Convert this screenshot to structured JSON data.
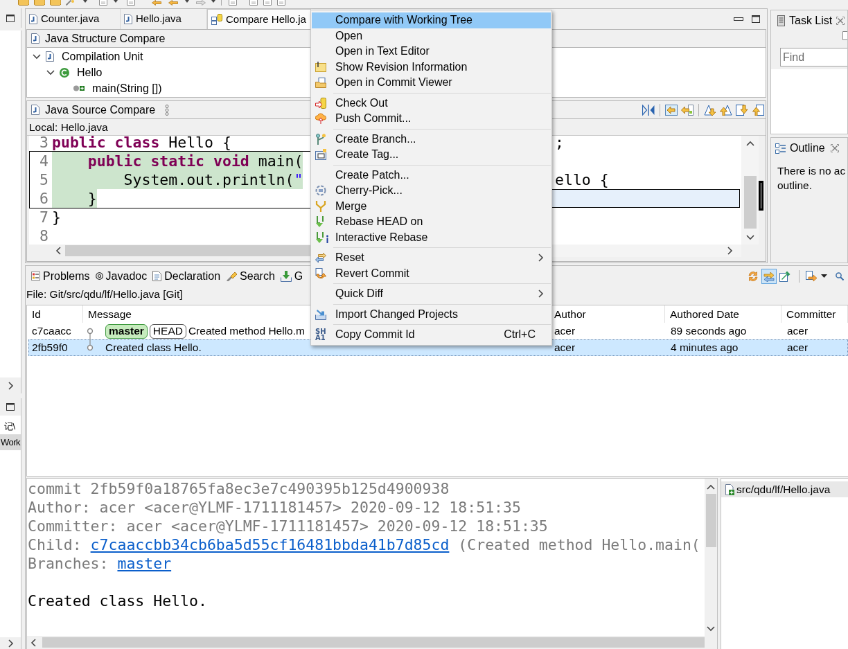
{
  "left_strip": {
    "items": [
      {
        "label": "记\\",
        "selected": false
      },
      {
        "label": "Work",
        "selected": true
      }
    ]
  },
  "editor": {
    "tabs": [
      {
        "label": "Counter.java",
        "kind": "java",
        "selected": false
      },
      {
        "label": "Hello.java",
        "kind": "java",
        "selected": false
      },
      {
        "label": "Compare Hello.ja",
        "kind": "compare",
        "selected": true
      }
    ],
    "structure_compare": {
      "title": "Java Structure Compare",
      "tree": [
        {
          "label": "Compilation Unit",
          "kind": "compilation_unit",
          "expanded": true,
          "children": [
            {
              "label": "Hello",
              "kind": "class",
              "expanded": true,
              "children": [
                {
                  "label": "main(String [])",
                  "kind": "method"
                }
              ]
            }
          ]
        }
      ]
    },
    "source_compare": {
      "title": "Java Source Compare",
      "left_label": "Local: Hello.java",
      "left_lines": [
        {
          "number": "3",
          "changed": false,
          "tokens": [
            {
              "kind": "keyword",
              "text": "public class"
            },
            {
              "kind": "plain",
              "text": " Hello {"
            }
          ]
        },
        {
          "number": "4",
          "changed": true,
          "tokens": [
            {
              "kind": "keyword",
              "text": "    public static void"
            },
            {
              "kind": "plain",
              "text": " main("
            }
          ]
        },
        {
          "number": "5",
          "changed": true,
          "tokens": [
            {
              "kind": "plain",
              "text": "        System.out.println("
            },
            {
              "kind": "string",
              "text": "\""
            }
          ]
        },
        {
          "number": "6",
          "changed": true,
          "tokens": [
            {
              "kind": "plain",
              "text": "    }"
            }
          ]
        },
        {
          "number": "7",
          "changed": false,
          "tokens": [
            {
              "kind": "plain",
              "text": "}"
            }
          ]
        },
        {
          "number": "8",
          "changed": false
        }
      ],
      "right_lines": [
        {
          "text": ";",
          "changed": false
        },
        {
          "changed": false
        },
        {
          "text": "ello {",
          "changed": false
        },
        {
          "changed": true
        }
      ]
    }
  },
  "task_list": {
    "title": "Task List",
    "find": {
      "placeholder": "Find"
    }
  },
  "outline": {
    "title": "Outline",
    "message_lines": [
      "There is no ac",
      "outline."
    ]
  },
  "history": {
    "tabs": [
      {
        "label": "Problems",
        "kind": "problems",
        "selected": false
      },
      {
        "label": "Javadoc",
        "kind": "javadoc",
        "selected": false
      },
      {
        "label": "Declaration",
        "kind": "declaration",
        "selected": false
      },
      {
        "label": "Search",
        "kind": "search",
        "selected": false
      },
      {
        "label": "G",
        "kind": "git",
        "selected": false
      }
    ],
    "toolbar": [
      {
        "on": false
      },
      {
        "on": true
      },
      {
        "on": false
      }
    ],
    "file_label": "File: Git/src/qdu/lf/Hello.java [Git]",
    "columns": [
      "Id",
      "Message",
      "Author",
      "Authored Date",
      "Committer"
    ],
    "rows": [
      {
        "id": "c7caacc",
        "refs": [
          {
            "kind": "branch",
            "label": "master"
          },
          {
            "kind": "head",
            "label": "HEAD"
          }
        ],
        "message": "Created method Hello.m",
        "author": "acer",
        "authored_date": "89 seconds ago",
        "committer": "acer",
        "selected": false
      },
      {
        "id": "2fb59f0",
        "message": "Created class Hello.",
        "author": "acer",
        "authored_date": "4 minutes ago",
        "committer": "acer",
        "selected": true
      }
    ],
    "details": {
      "lines": [
        {
          "parts": [
            {
              "kind": "plain",
              "text": "commit 2fb59f0a18765fa8ec3e7c490395b125d4900938"
            }
          ]
        },
        {
          "parts": [
            {
              "kind": "plain",
              "text": "Author: acer <acer@YLMF-1711181457> 2020-09-12 18:51:35"
            }
          ]
        },
        {
          "parts": [
            {
              "kind": "plain",
              "text": "Committer: acer <acer@YLMF-1711181457> 2020-09-12 18:51:35"
            }
          ]
        },
        {
          "parts": [
            {
              "kind": "plain",
              "text": "Child: "
            },
            {
              "kind": "link",
              "text": "c7caaccbb34cb6ba5d55cf16481bbda41b7d85cd"
            },
            {
              "kind": "plain",
              "text": " (Created method Hello.main("
            }
          ]
        },
        {
          "parts": [
            {
              "kind": "plain",
              "text": "Branches: "
            },
            {
              "kind": "link",
              "text": "master"
            }
          ]
        }
      ],
      "message": "Created class Hello."
    },
    "files": [
      {
        "path": "src/qdu/lf/Hello.java",
        "selected": true
      }
    ]
  },
  "context_menu": {
    "groups": [
      [
        {
          "label": "Compare with Working Tree",
          "selected": true,
          "submenu": false
        },
        {
          "label": "Open",
          "selected": false,
          "submenu": false
        },
        {
          "label": "Open in Text Editor",
          "selected": false,
          "submenu": false
        },
        {
          "label": "Show Revision Information",
          "selected": false,
          "submenu": false
        },
        {
          "label": "Open in Commit Viewer",
          "selected": false,
          "submenu": false
        }
      ],
      [
        {
          "label": "Check Out",
          "selected": false,
          "submenu": false
        },
        {
          "label": "Push Commit...",
          "selected": false,
          "submenu": false
        }
      ],
      [
        {
          "label": "Create Branch...",
          "selected": false,
          "submenu": false
        },
        {
          "label": "Create Tag...",
          "selected": false,
          "submenu": false
        }
      ],
      [
        {
          "label": "Create Patch...",
          "selected": false,
          "submenu": false
        },
        {
          "label": "Cherry-Pick...",
          "selected": false,
          "submenu": false
        },
        {
          "label": "Merge",
          "selected": false,
          "submenu": false
        },
        {
          "label": "Rebase HEAD on",
          "selected": false,
          "submenu": false
        },
        {
          "label": "Interactive Rebase",
          "selected": false,
          "submenu": false
        }
      ],
      [
        {
          "label": "Reset",
          "selected": false,
          "submenu": true
        },
        {
          "label": "Revert Commit",
          "selected": false,
          "submenu": false
        }
      ],
      [
        {
          "label": "Quick Diff",
          "selected": false,
          "submenu": true
        }
      ],
      [
        {
          "label": "Import Changed Projects",
          "selected": false,
          "submenu": false
        }
      ],
      [
        {
          "label": "Copy Commit Id",
          "selected": false,
          "submenu": false,
          "shortcut": "Ctrl+C",
          "icon_text_lines": [
            "SH",
            "A1"
          ]
        }
      ]
    ]
  }
}
